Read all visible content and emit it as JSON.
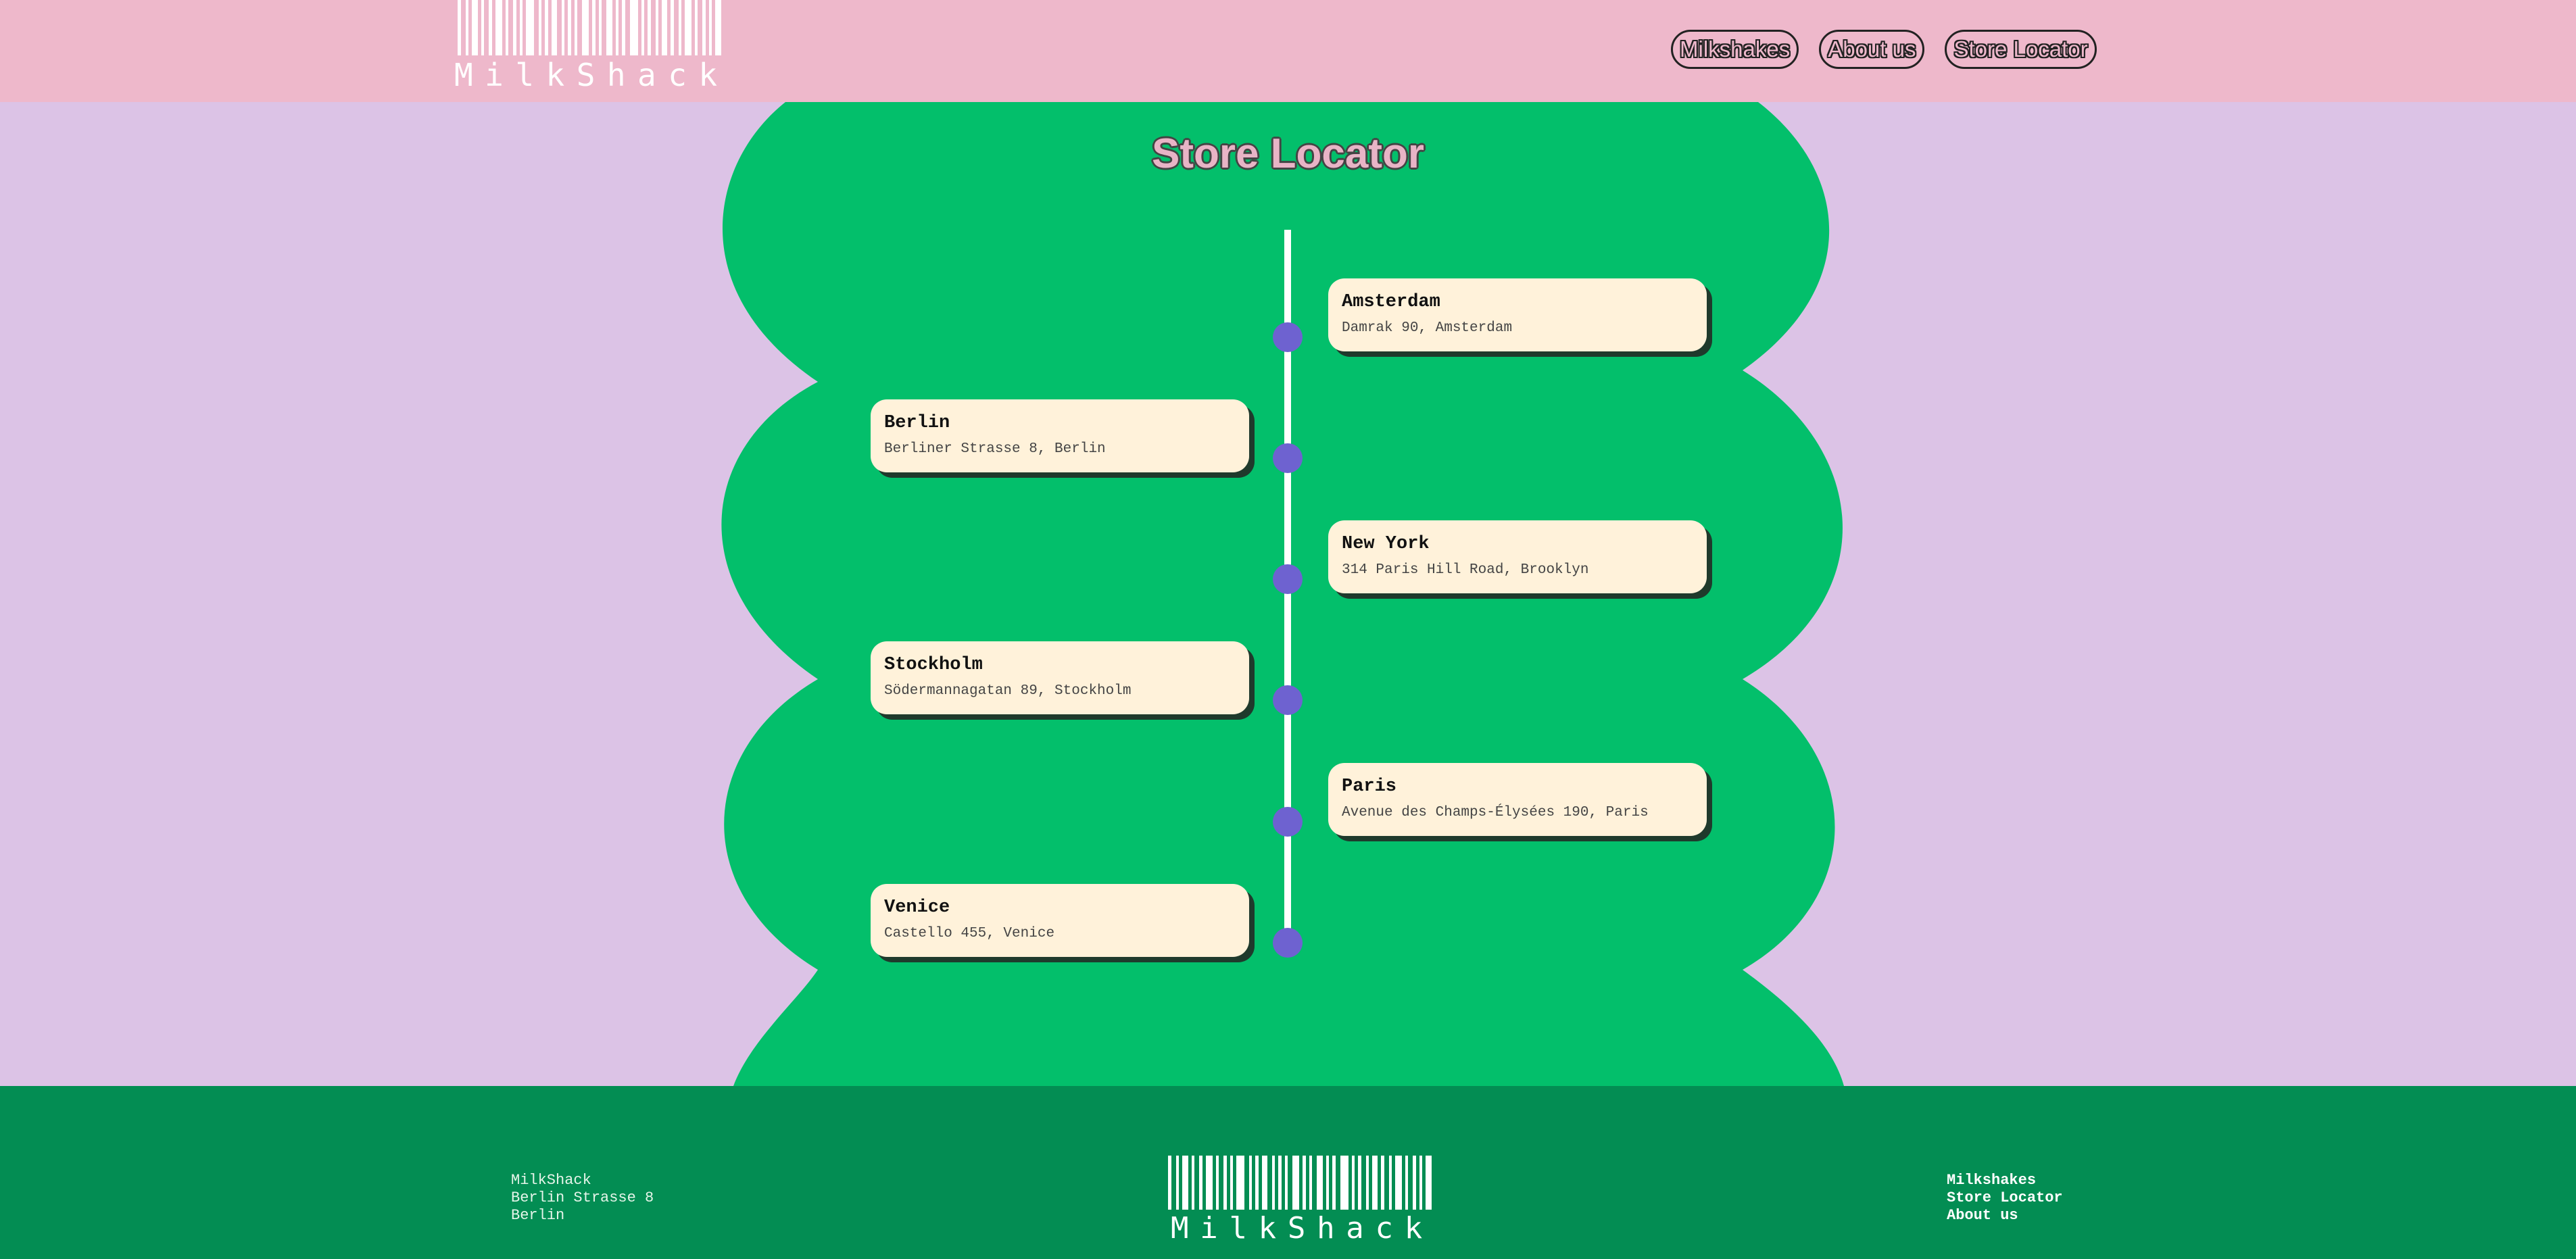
{
  "header": {
    "logo_text": "MilkShack",
    "nav": [
      {
        "label": "Milkshakes"
      },
      {
        "label": "About us"
      },
      {
        "label": "Store Locator"
      }
    ]
  },
  "main": {
    "title": "Store Locator",
    "stores": [
      {
        "name": "Amsterdam",
        "address": "Damrak 90, Amsterdam",
        "side": "right"
      },
      {
        "name": "Berlin",
        "address": "Berliner Strasse 8, Berlin",
        "side": "left"
      },
      {
        "name": "New York",
        "address": "314 Paris Hill Road, Brooklyn",
        "side": "right"
      },
      {
        "name": "Stockholm",
        "address": "Södermannagatan 89, Stockholm",
        "side": "left"
      },
      {
        "name": "Paris",
        "address": "Avenue des Champs-Élysées 190, Paris",
        "side": "right"
      },
      {
        "name": "Venice",
        "address": "Castello 455, Venice",
        "side": "left"
      }
    ]
  },
  "footer": {
    "address_lines": [
      "MilkShack",
      "Berlin Strasse 8",
      "Berlin"
    ],
    "logo_text": "MilkShack",
    "links": [
      {
        "label": "Milkshakes"
      },
      {
        "label": "Store Locator"
      },
      {
        "label": "About us"
      }
    ]
  },
  "colors": {
    "header_bg": "#eeb8cb",
    "page_bg": "#dcc3e6",
    "blob_green": "#03bf6b",
    "footer_green": "#038d53",
    "card_bg": "#fff2da",
    "dot_purple": "#6e62d0"
  }
}
